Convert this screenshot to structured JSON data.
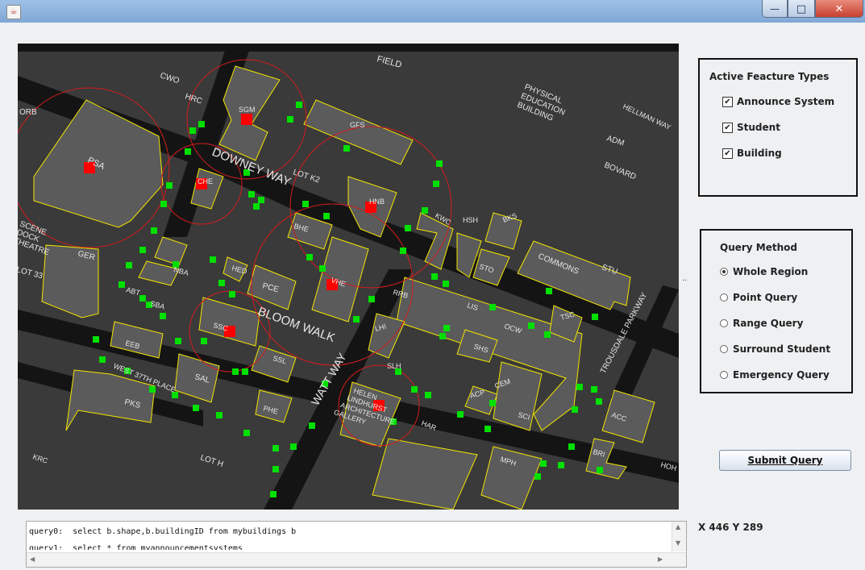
{
  "window": {
    "app_icon": "java-icon",
    "controls": {
      "minimize_glyph": "—",
      "maximize_glyph": "□",
      "close_glyph": "✕"
    }
  },
  "map": {
    "labels": {
      "field": "FIELD",
      "cwo": "CWO",
      "hrc": "HRC",
      "sgm": "SGM",
      "orb": "ORB",
      "psa": "PSA",
      "downey_way": "DOWNEY WAY",
      "lot_k2": "LOT K2",
      "gfs": "GFS",
      "physical_education": "PHYSICAL EDUCATION BUILDING",
      "hellman_way": "HELLMAN WAY",
      "adm": "ADM",
      "bovard": "BOVARD",
      "che": "CHE",
      "hnb": "HNB",
      "kwc": "KWC",
      "hsh": "HSH",
      "bks": "BKS",
      "scene_dock": "SCENE DOCK THEATRE",
      "ger": "GER",
      "bhe": "BHE",
      "sto": "STO",
      "commons": "COMMONS",
      "stu": "STU",
      "lot_33": "LOT 33",
      "nba": "NBA",
      "hed": "HED",
      "vhe": "VHE",
      "trousdale": "TROUSDALE PARKWAY",
      "abt": "ABT",
      "sba": "SBA",
      "pce": "PCE",
      "rrb": "RRB",
      "lis": "LIS",
      "ocw": "OCW",
      "tsc": "TSC",
      "bloom_walk": "BLOOM WALK",
      "ssc": "SSC",
      "lhi": "LHI",
      "shs": "SHS",
      "eeb": "EEB",
      "ssl": "SSL",
      "sal": "SAL",
      "west_37th": "WEST 37TH PLACE",
      "watt_way": "WATT WAY",
      "slh": "SLH",
      "cem": "CEM",
      "pks": "PKS",
      "phe": "PHE",
      "helen_lindhurst": "HELEN LINDHURST ARCHITECTURE GALLERY",
      "acp": "ACP",
      "sci": "SCI",
      "acc": "ACC",
      "har": "HAR",
      "krc": "KRC",
      "lot_h": "LOT H",
      "mph": "MPH",
      "bri": "BRI",
      "hoh": "HOH"
    },
    "colors": {
      "background": "#3a3a3a",
      "building_fill": "#5b5b5b",
      "building_outline": "#f2e600",
      "road": "#141414",
      "label": "#e6e6e6",
      "announce_circle": "#d41c1c",
      "announce_marker": "#ff0000",
      "student_marker": "#00e000"
    }
  },
  "feature_panel": {
    "title": "Active Feacture Types",
    "items": [
      {
        "label": "Announce System",
        "checked": true
      },
      {
        "label": "Student",
        "checked": true
      },
      {
        "label": "Building",
        "checked": true
      }
    ]
  },
  "query_panel": {
    "title": "Query Method",
    "options": [
      {
        "label": "Whole Region",
        "selected": true
      },
      {
        "label": "Point Query",
        "selected": false
      },
      {
        "label": "Range Query",
        "selected": false
      },
      {
        "label": "Surround Student",
        "selected": false
      },
      {
        "label": "Emergency Query",
        "selected": false
      }
    ]
  },
  "submit_label": "Submit Query",
  "coords_text": "X 446 Y 289",
  "console_lines": [
    "query0:  select b.shape,b.buildingID from mybuildings b",
    "query1:  select * from myannouncementsystems"
  ],
  "splitter_glyph": ".."
}
